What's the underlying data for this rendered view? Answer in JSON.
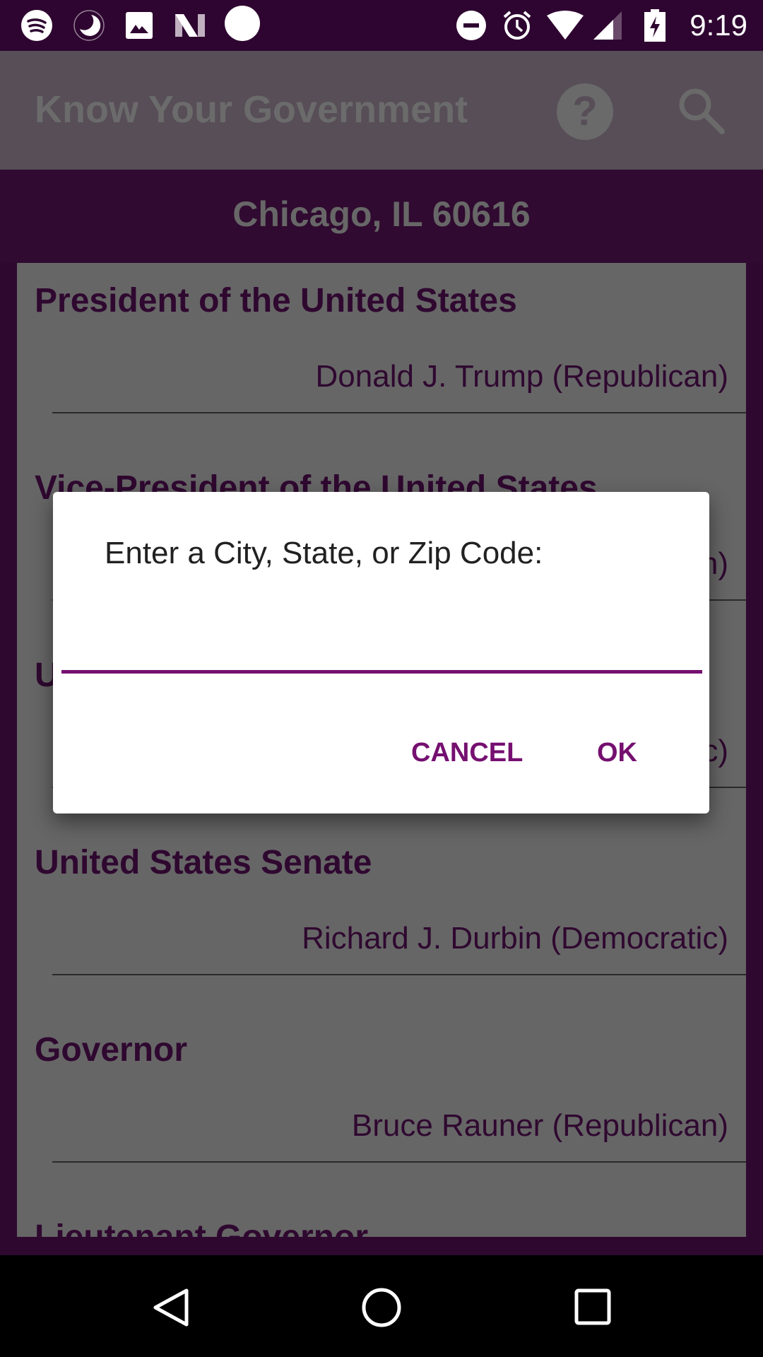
{
  "status_bar": {
    "time": "9:19",
    "icons_left": [
      "spotify-icon",
      "night-mode-icon",
      "image-icon",
      "n-icon",
      "circle-icon"
    ],
    "icons_right": [
      "do-not-disturb-icon",
      "alarm-icon",
      "wifi-icon",
      "signal-icon",
      "battery-charging-icon"
    ]
  },
  "toolbar": {
    "title": "Know Your Government",
    "help_icon": "?",
    "search_icon": "search-icon"
  },
  "location": "Chicago, IL 60616",
  "offices": [
    {
      "title": "President of the United States",
      "name": "Donald J. Trump (Republican)"
    },
    {
      "title": "Vice-President of the United States",
      "name": "n)"
    },
    {
      "title": "U",
      "name": "c)"
    },
    {
      "title": "United States Senate",
      "name": "Richard J. Durbin (Democratic)"
    },
    {
      "title": "Governor",
      "name": "Bruce Rauner (Republican)"
    },
    {
      "title": "Lieutenant Governor",
      "name": ""
    }
  ],
  "dialog": {
    "message": "Enter a City, State, or Zip Code:",
    "input_value": "",
    "cancel_label": "CANCEL",
    "ok_label": "OK"
  },
  "colors": {
    "primary": "#751070",
    "status_bar": "#2e0530",
    "background": "#300a30"
  }
}
